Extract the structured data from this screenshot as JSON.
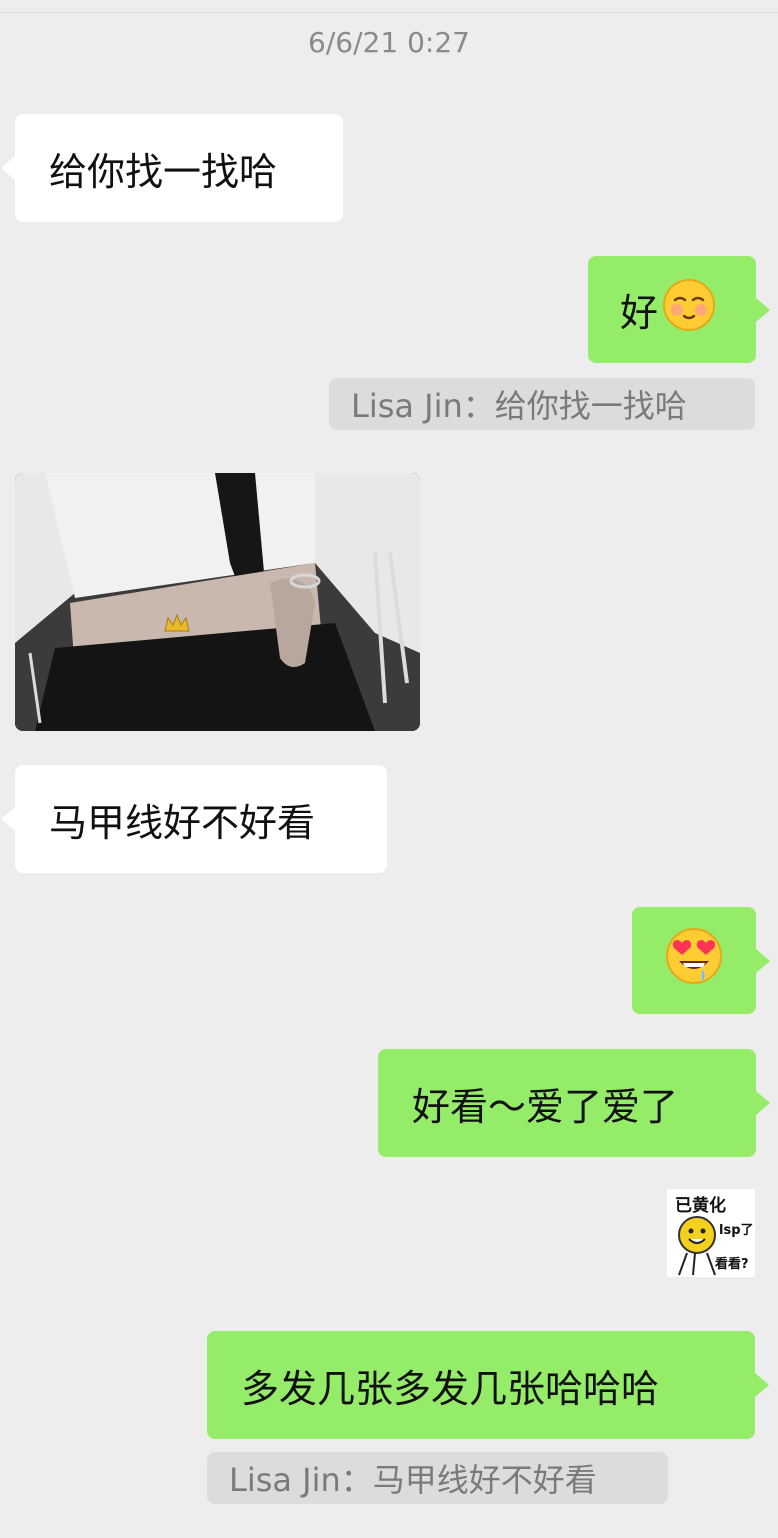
{
  "timestamp": "6/6/21 0:27",
  "messages": {
    "m1": "给你找一找哈",
    "m2": "好",
    "m3_quote": "Lisa Jin：给你找一找哈",
    "m5": "马甲线好不好看",
    "m7": "好看～爱了爱了",
    "m9": "多发几张多发几张哈哈哈",
    "m9_quote": "Lisa Jin：马甲线好不好看"
  },
  "icons": {
    "smile_blush": "smiling-face-with-blush-icon",
    "heart_eyes": "heart-eyes-drool-icon",
    "crown": "crown-icon"
  },
  "sticker": {
    "line1": "已黄化",
    "line2": "lsp了",
    "line3": "看看?"
  },
  "colors": {
    "background": "#ededed",
    "incoming_bubble": "#ffffff",
    "outgoing_bubble": "#95ec69",
    "quote_bg": "#dcdcdc"
  }
}
